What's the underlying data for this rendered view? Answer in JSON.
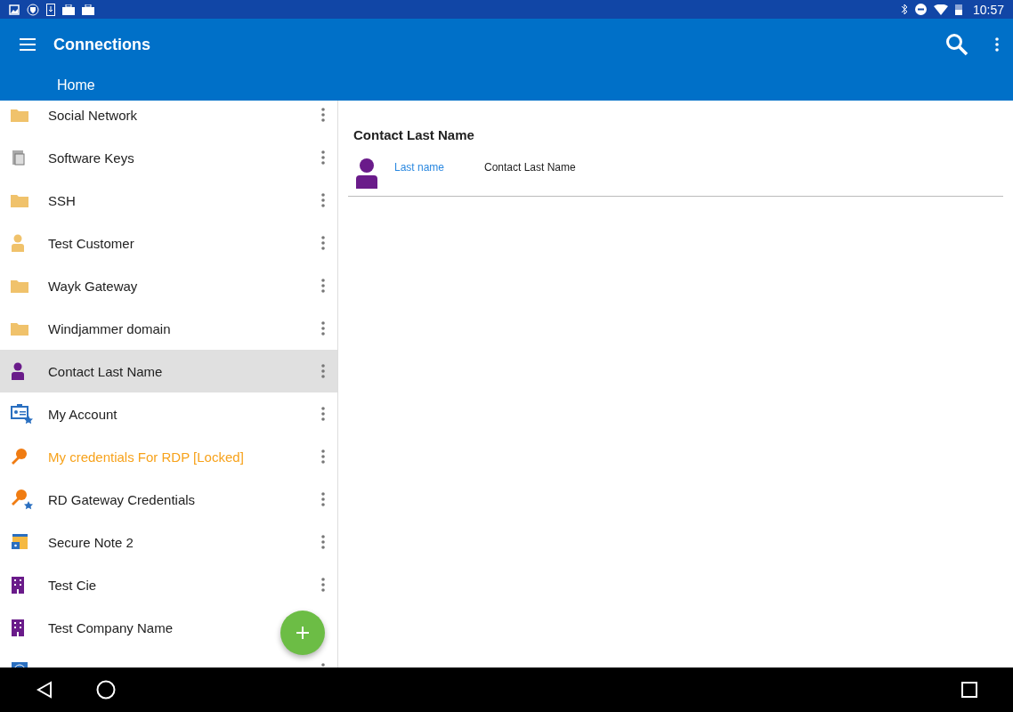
{
  "status_bar": {
    "time": "10:57"
  },
  "app_bar": {
    "title": "Connections",
    "breadcrumb": "Home"
  },
  "list": [
    {
      "label": "Social Network",
      "kind": "folder",
      "selected": false,
      "locked": false,
      "covered": false
    },
    {
      "label": "Software Keys",
      "kind": "software",
      "selected": false,
      "locked": false,
      "covered": false
    },
    {
      "label": "SSH",
      "kind": "folder",
      "selected": false,
      "locked": false,
      "covered": false
    },
    {
      "label": "Test Customer",
      "kind": "customer",
      "selected": false,
      "locked": false,
      "covered": false
    },
    {
      "label": "Wayk Gateway",
      "kind": "folder",
      "selected": false,
      "locked": false,
      "covered": false
    },
    {
      "label": "Windjammer domain",
      "kind": "folder",
      "selected": false,
      "locked": false,
      "covered": false
    },
    {
      "label": "Contact Last Name",
      "kind": "contact",
      "selected": true,
      "locked": false,
      "covered": false
    },
    {
      "label": "My Account",
      "kind": "account",
      "selected": false,
      "locked": false,
      "covered": false
    },
    {
      "label": "My credentials For RDP [Locked]",
      "kind": "key",
      "selected": false,
      "locked": true,
      "covered": false
    },
    {
      "label": "RD Gateway Credentials",
      "kind": "key-star",
      "selected": false,
      "locked": false,
      "covered": false
    },
    {
      "label": "Secure Note 2",
      "kind": "note",
      "selected": false,
      "locked": false,
      "covered": false
    },
    {
      "label": "Test Cie",
      "kind": "company",
      "selected": false,
      "locked": false,
      "covered": false
    },
    {
      "label": "Test Company Name",
      "kind": "company",
      "selected": false,
      "locked": false,
      "covered": true
    },
    {
      "kind": "web",
      "selected": false,
      "covered": false
    }
  ],
  "detail": {
    "title": "Contact Last Name",
    "fields": [
      {
        "label": "Last name",
        "value": "Contact Last Name"
      }
    ]
  }
}
